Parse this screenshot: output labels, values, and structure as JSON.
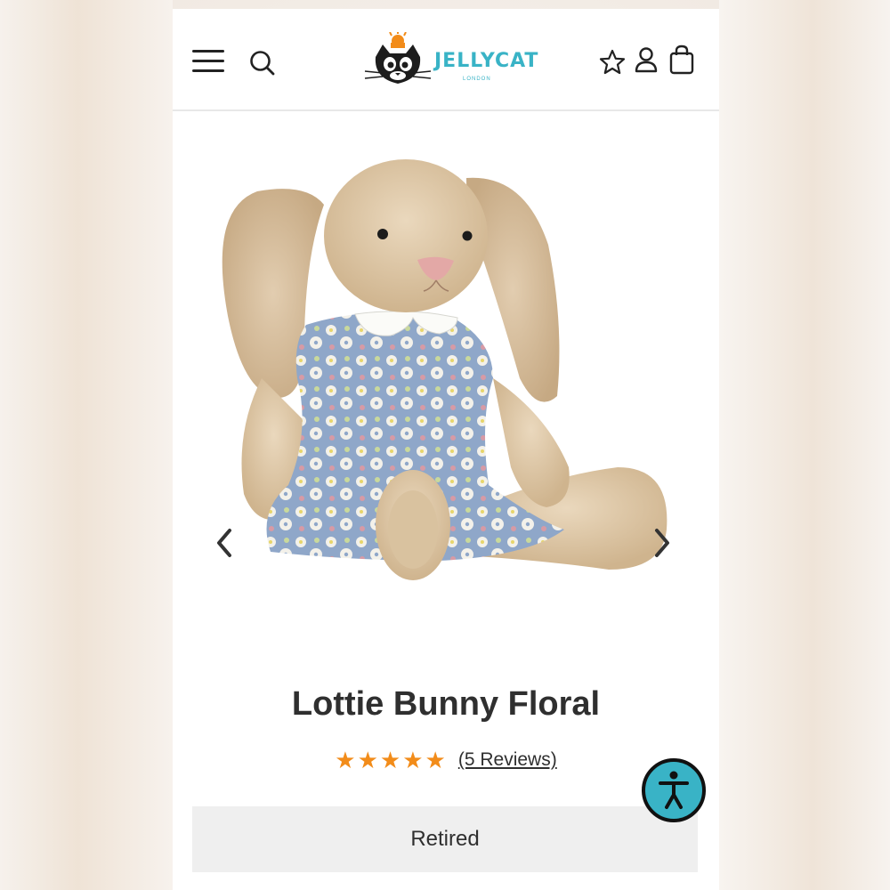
{
  "header": {
    "brand_name": "JELLYCAT",
    "brand_sub": "LONDON",
    "menu_icon": "hamburger-icon",
    "search_icon": "search-icon",
    "wishlist_icon": "star-icon",
    "account_icon": "user-icon",
    "bag_icon": "bag-icon"
  },
  "gallery": {
    "image_subject": "plush bunny in floral dress",
    "prev_icon": "chevron-left-icon",
    "next_icon": "chevron-right-icon"
  },
  "product": {
    "title": "Lottie Bunny Floral",
    "rating": 5,
    "rating_max": 5,
    "reviews_label": "(5 Reviews)",
    "status_label": "Retired"
  },
  "colors": {
    "brand": "#39b3c6",
    "star": "#f28c1a",
    "accessibility": "#39b3c6"
  },
  "accessibility_icon": "accessibility-icon"
}
